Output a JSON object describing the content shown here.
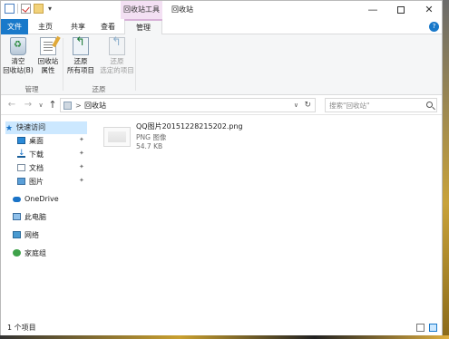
{
  "title_bar": {
    "context_tab_group": "回收站工具",
    "window_title": "回收站",
    "minimize": "—",
    "maximize": "☐",
    "close": "✕"
  },
  "tabs": {
    "file": "文件",
    "home": "主页",
    "share": "共享",
    "view": "查看",
    "manage": "管理"
  },
  "ribbon": {
    "empty_bin_line1": "清空",
    "empty_bin_line2": "回收站(B)",
    "bin_props_line1": "回收站",
    "bin_props_line2": "属性",
    "restore_all_line1": "还原",
    "restore_all_line2": "所有项目",
    "restore_sel_line1": "还原",
    "restore_sel_line2": "选定的项目",
    "group_manage": "管理",
    "group_restore": "还原"
  },
  "address_bar": {
    "back": "←",
    "forward": "→",
    "recent": "∨",
    "up": "↑",
    "separator": ">",
    "location": "回收站",
    "dropdown": "∨",
    "refresh": "↻"
  },
  "search": {
    "placeholder": "搜索\"回收站\""
  },
  "nav_pane": {
    "quick_access": "快速访问",
    "desktop": "桌面",
    "downloads": "下载",
    "documents": "文档",
    "pictures": "图片",
    "onedrive": "OneDrive",
    "this_pc": "此电脑",
    "network": "网络",
    "homegroup": "家庭组"
  },
  "file": {
    "name": "QQ图片20151228215202.png",
    "type": "PNG 图像",
    "size": "54.7 KB"
  },
  "status_bar": {
    "item_count": "1 个项目"
  },
  "icons": {
    "quick_access": "star-icon",
    "desktop": "desktop-icon",
    "downloads": "download-icon",
    "documents": "document-icon",
    "pictures": "pictures-icon",
    "onedrive": "cloud-icon",
    "this_pc": "computer-icon",
    "network": "network-icon",
    "homegroup": "homegroup-icon",
    "pin": "pin-icon"
  },
  "colors": {
    "file_tab": "#1979ca",
    "context_tab": "#f3e0f3",
    "selection": "#cce8ff"
  }
}
